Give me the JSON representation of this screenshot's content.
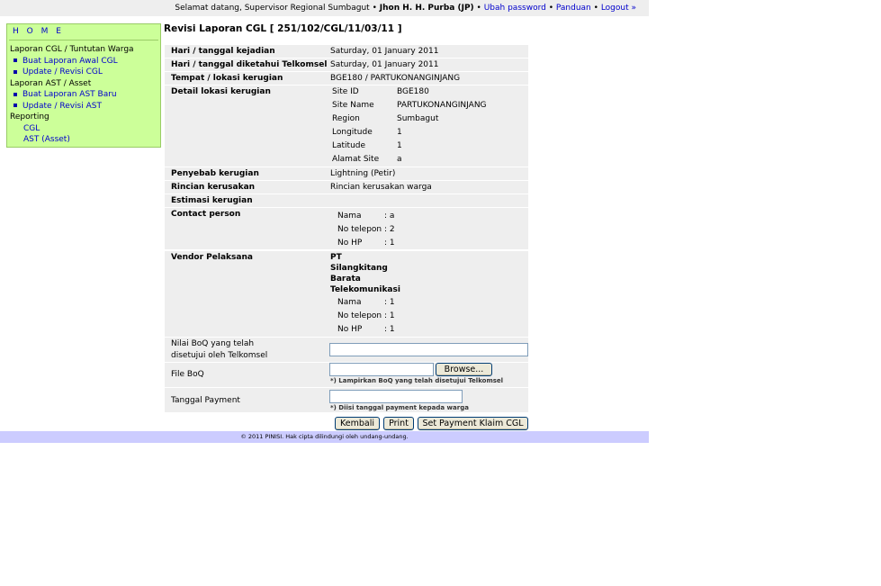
{
  "header": {
    "welcome": "Selamat datang, Supervisor Regional Sumbagut",
    "user": "Jhon H. H. Purba (JP)",
    "links": [
      "Ubah password",
      "Panduan",
      "Logout »"
    ]
  },
  "sidebar": {
    "home": "H O M E",
    "section_cgl": "Laporan CGL / Tuntutan Warga",
    "buat_cgl": "Buat Laporan Awal CGL",
    "update_cgl": "Update / Revisi CGL",
    "section_ast": "Laporan AST / Asset",
    "buat_ast": "Buat Laporan AST Baru",
    "update_ast": "Update / Revisi AST",
    "section_reporting": "Reporting",
    "rep_cgl": "CGL",
    "rep_ast": "AST (Asset)"
  },
  "page": {
    "title": "Revisi Laporan CGL [ 251/102/CGL/11/03/11 ]"
  },
  "form": {
    "hari_kejadian": {
      "label": "Hari / tanggal kejadian",
      "value": "Saturday, 01 January 2011"
    },
    "hari_diketahui": {
      "label": "Hari / tanggal diketahui Telkomsel",
      "value": "Saturday, 01 January 2011"
    },
    "tempat": {
      "label": "Tempat / lokasi kerugian",
      "value": "BGE180 / PARTUKONANGINJANG"
    },
    "detail": {
      "label": "Detail lokasi kerugian",
      "site_id": {
        "k": "Site ID",
        "v": "BGE180"
      },
      "site_name": {
        "k": "Site Name",
        "v": "PARTUKONANGINJANG"
      },
      "region": {
        "k": "Region",
        "v": "Sumbagut"
      },
      "longitude": {
        "k": "Longitude",
        "v": "1"
      },
      "latitude": {
        "k": "Latitude",
        "v": "1"
      },
      "alamat": {
        "k": "Alamat Site",
        "v": "a"
      }
    },
    "penyebab": {
      "label": "Penyebab kerugian",
      "value": "Lightning (Petir)"
    },
    "rincian": {
      "label": "Rincian kerusakan",
      "value": "Rincian kerusakan warga"
    },
    "estimasi": {
      "label": "Estimasi kerugian",
      "value": ""
    },
    "contact": {
      "label": "Contact person",
      "nama": {
        "k": "Nama",
        "v": ": a"
      },
      "telepon": {
        "k": "No telepon",
        "v": ": 2"
      },
      "hp": {
        "k": "No HP",
        "v": ": 1"
      }
    },
    "vendor": {
      "label": "Vendor Pelaksana",
      "name_lines": [
        "PT",
        "Silangkitang",
        "Barata",
        "Telekomunikasi"
      ],
      "nama": {
        "k": "Nama",
        "v": ": 1"
      },
      "telepon": {
        "k": "No telepon",
        "v": ": 1"
      },
      "hp": {
        "k": "No HP",
        "v": ": 1"
      }
    },
    "nilai_boq": {
      "label_line1": "Nilai BoQ yang telah",
      "label_line2": "disetujui oleh Telkomsel",
      "value": ""
    },
    "file_boq": {
      "label": "File BoQ",
      "browse": "Browse...",
      "note": "*) Lampirkan BoQ yang telah disetujui Telkomsel"
    },
    "tanggal_payment": {
      "label": "Tanggal Payment",
      "value": "",
      "note": "*) Diisi tanggal payment kepada warga"
    }
  },
  "buttons": {
    "kembali": "Kembali",
    "print": "Print",
    "set_payment": "Set Payment Klaim CGL"
  },
  "footer": {
    "text": "© 2011 PINISI. Hak cipta dilindungi oleh undang-undang."
  }
}
